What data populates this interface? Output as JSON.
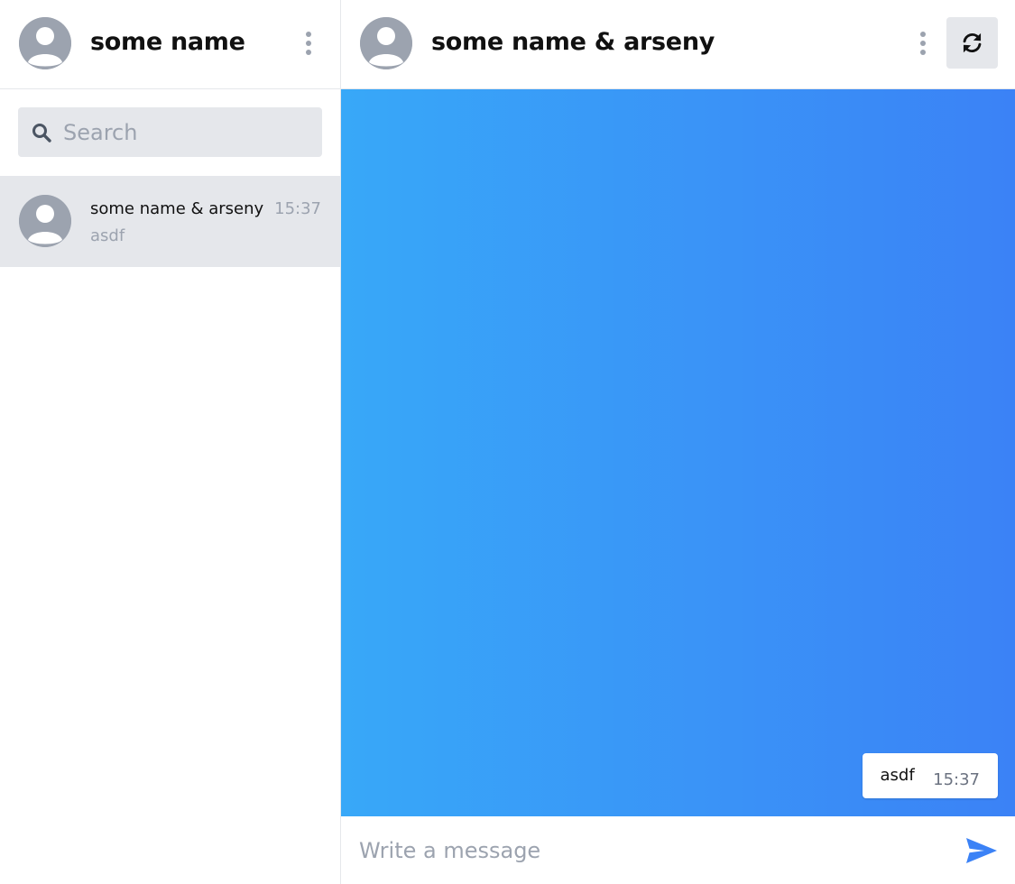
{
  "colors": {
    "accent": "#3b82f6",
    "gradient_start": "#38a8f8",
    "gradient_end": "#3b82f6",
    "avatar_gray": "#9ca3af",
    "selected_bg": "#e5e7eb"
  },
  "sidebar": {
    "header": {
      "title": "some name",
      "avatar_icon": "user-avatar-icon",
      "menu_icon": "kebab-menu-icon"
    },
    "search": {
      "placeholder": "Search",
      "value": "",
      "icon": "search-icon"
    },
    "conversations": [
      {
        "name": "some name & arseny",
        "time": "15:37",
        "preview": "asdf",
        "selected": true
      }
    ]
  },
  "chat": {
    "header": {
      "title": "some name & arseny",
      "avatar_icon": "user-avatar-icon",
      "menu_icon": "kebab-menu-icon",
      "refresh_icon": "refresh-icon"
    },
    "messages": [
      {
        "text": "asdf",
        "time": "15:37",
        "outgoing": true
      }
    ],
    "composer": {
      "placeholder": "Write a message",
      "value": "",
      "send_icon": "send-icon"
    }
  }
}
